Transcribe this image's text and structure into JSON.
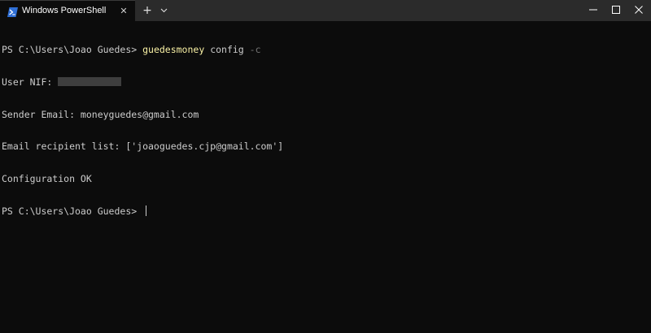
{
  "titlebar": {
    "tab_title": "Windows PowerShell",
    "tab_close": "✕",
    "new_tab": "+",
    "icons": {
      "tab": "powershell-icon",
      "dropdown": "chevron-down-icon",
      "minimize": "minimize-icon",
      "maximize": "maximize-icon",
      "close": "close-icon"
    }
  },
  "terminal": {
    "prompt1": "PS C:\\Users\\Joao Guedes> ",
    "command": "guedesmoney",
    "command_arg": " config ",
    "command_flag": "-c",
    "nif_label": "User NIF: ",
    "sender_email": "Sender Email: moneyguedes@gmail.com",
    "recipients": "Email recipient list: ['joaoguedes.cjp@gmail.com']",
    "status": "Configuration OK",
    "prompt2": "PS C:\\Users\\Joao Guedes> "
  },
  "colors": {
    "background": "#0c0c0c",
    "titlebar": "#2b2b2b",
    "text": "#cccccc",
    "command": "#f9f1a5",
    "flag": "#767676"
  }
}
